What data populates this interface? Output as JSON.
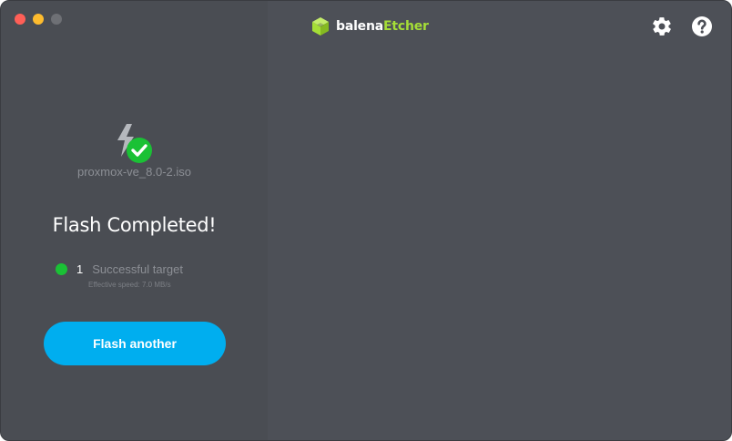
{
  "app": {
    "brand_prefix": "balena",
    "brand_suffix": "Etcher",
    "brand_color": "#a5de37"
  },
  "window_controls": [
    {
      "name": "close",
      "color": "#ff5f57"
    },
    {
      "name": "minimize",
      "color": "#febc2e"
    },
    {
      "name": "maximize",
      "color": "#6e7075"
    }
  ],
  "toolbar": {
    "settings_icon": "gear-icon",
    "help_icon": "question-circle-icon"
  },
  "flash": {
    "file_icon": "flash-success-icon",
    "file_name": "proxmox-ve_8.0-2.iso",
    "title": "Flash Completed!",
    "success_count": "1",
    "success_label": "Successful target",
    "status_color": "#1ac135",
    "effective_speed": "Effective speed: 7.0 MB/s",
    "button_label": "Flash another",
    "button_color": "#00aeef"
  }
}
